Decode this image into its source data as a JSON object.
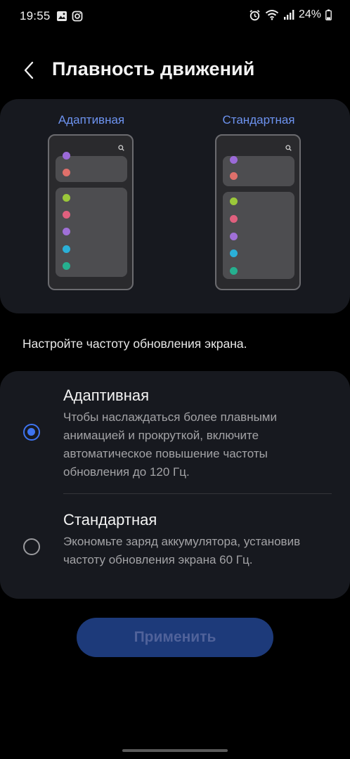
{
  "status_bar": {
    "time": "19:55",
    "battery": "24%",
    "icons_left": [
      "gallery-icon",
      "instagram-icon"
    ],
    "icons_right": [
      "alarm-icon",
      "wifi-icon",
      "signal-icon",
      "battery-icon"
    ]
  },
  "header": {
    "title": "Плавность движений"
  },
  "preview": {
    "adaptive_label": "Адаптивная",
    "standard_label": "Стандартная",
    "dot_colors": [
      "#9b6ad8",
      "#e0706b",
      "#9bc83a",
      "#e0607e",
      "#a070d8",
      "#2bb0d8",
      "#25b08f"
    ]
  },
  "instructions": "Настройте частоту обновления экрана.",
  "options": [
    {
      "title": "Адаптивная",
      "description": "Чтобы наслаждаться более плавными анимацией и прокруткой, включите автоматическое повышение частоты обновления до 120 Гц.",
      "selected": true
    },
    {
      "title": "Стандартная",
      "description": "Экономьте заряд аккумулятора, установив частоту обновления экрана 60 Гц.",
      "selected": false
    }
  ],
  "apply_button": "Применить",
  "colors": {
    "accent": "#3e74f0",
    "card_bg": "#17191f",
    "label_blue": "#6d93f0",
    "button_bg": "#1d3a7a"
  }
}
